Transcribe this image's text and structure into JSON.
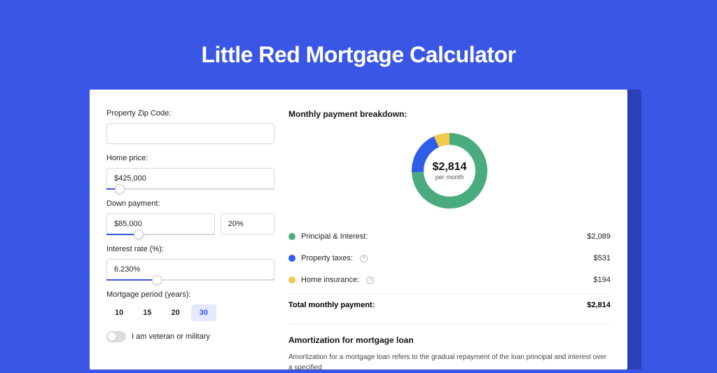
{
  "title": "Little Red Mortgage Calculator",
  "form": {
    "zip_label": "Property Zip Code:",
    "zip_value": "",
    "price_label": "Home price:",
    "price_value": "$425,000",
    "price_slider_pct": 8,
    "down_label": "Down payment:",
    "down_value": "$85,000",
    "down_pct_value": "20%",
    "down_slider_pct": 20,
    "rate_label": "Interest rate (%):",
    "rate_value": "6.230%",
    "rate_slider_pct": 30,
    "period_label": "Mortgage period (years):",
    "periods": [
      "10",
      "15",
      "20",
      "30"
    ],
    "period_selected": "30",
    "veteran_label": "I am veteran or military"
  },
  "breakdown": {
    "title": "Monthly payment breakdown:",
    "total_amount": "$2,814",
    "per_month": "per month",
    "items": [
      {
        "label": "Principal & Interest:",
        "value": "$2,089",
        "color": "green"
      },
      {
        "label": "Property taxes:",
        "value": "$531",
        "color": "blue",
        "info": true
      },
      {
        "label": "Home insurance:",
        "value": "$194",
        "color": "yellow",
        "info": true
      }
    ],
    "total_label": "Total monthly payment:",
    "total_value": "$2,814"
  },
  "amortization": {
    "title": "Amortization for mortgage loan",
    "text": "Amortization for a mortgage loan refers to the gradual repayment of the loan principal and interest over a specified"
  },
  "colors": {
    "accent": "#3a56e4",
    "green": "#4aab7e",
    "blue": "#2e5de8",
    "yellow": "#f2c94c"
  },
  "chart_data": {
    "type": "pie",
    "title": "Monthly payment breakdown",
    "series": [
      {
        "name": "Principal & Interest",
        "value": 2089,
        "color": "#4aab7e"
      },
      {
        "name": "Property taxes",
        "value": 531,
        "color": "#2e5de8"
      },
      {
        "name": "Home insurance",
        "value": 194,
        "color": "#f2c94c"
      }
    ],
    "total": 2814,
    "center_label": "$2,814",
    "center_sublabel": "per month"
  }
}
